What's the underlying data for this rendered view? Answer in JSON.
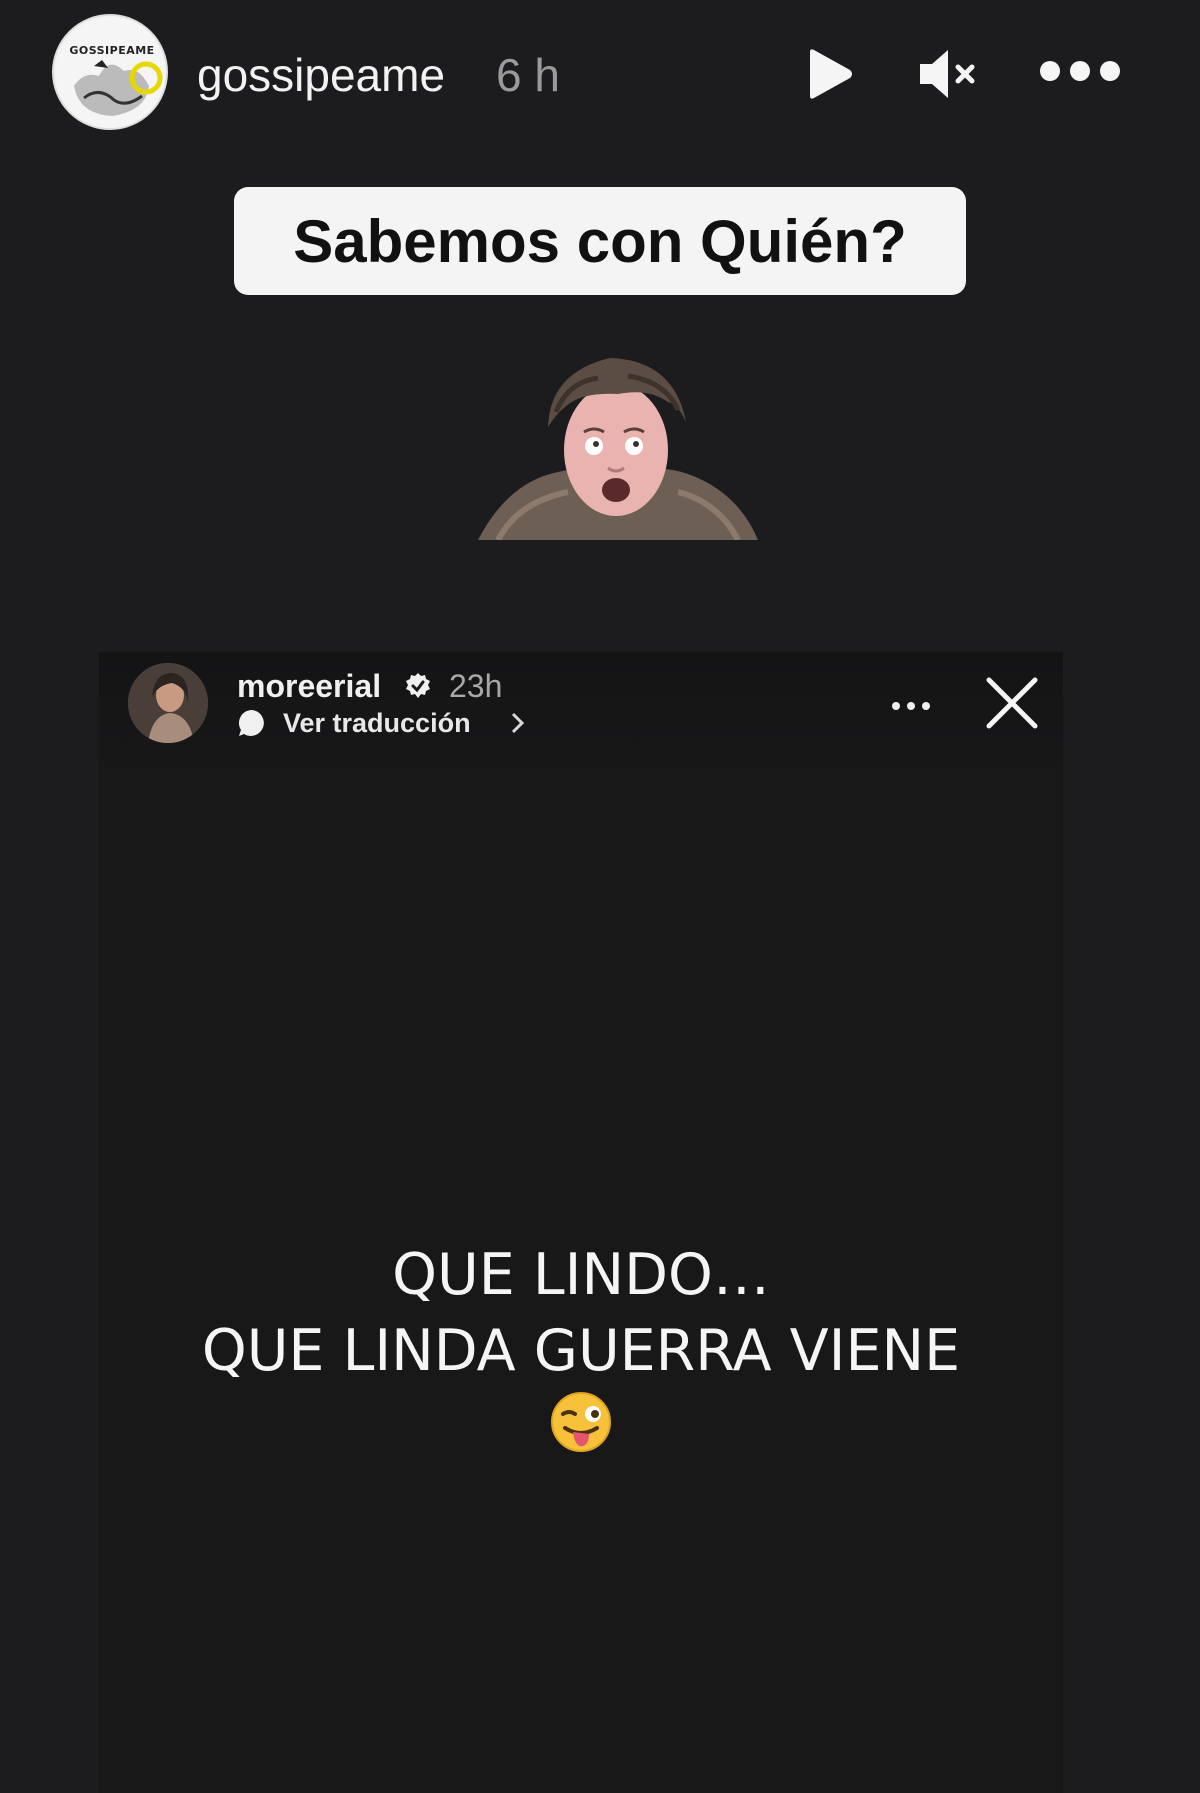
{
  "header": {
    "username": "gossipeame",
    "time": "6 h",
    "avatar_text": "GOSSIPEAME",
    "icons": [
      "play-icon",
      "mute-icon",
      "more-icon"
    ]
  },
  "question_sticker": {
    "text": "Sabemos con Quién?"
  },
  "reshared_story": {
    "username": "moreerial",
    "verified": true,
    "time": "23h",
    "translate_label": "Ver traducción",
    "lines": [
      "QUE LINDO…",
      "QUE LINDA GUERRA VIENE"
    ],
    "emoji": "winking-face-with-tongue"
  },
  "colors": {
    "background": "#1c1c1e",
    "sticker_background": "#f4f4f4",
    "text": "#ffffff",
    "muted_text": "#9a9a9a"
  }
}
